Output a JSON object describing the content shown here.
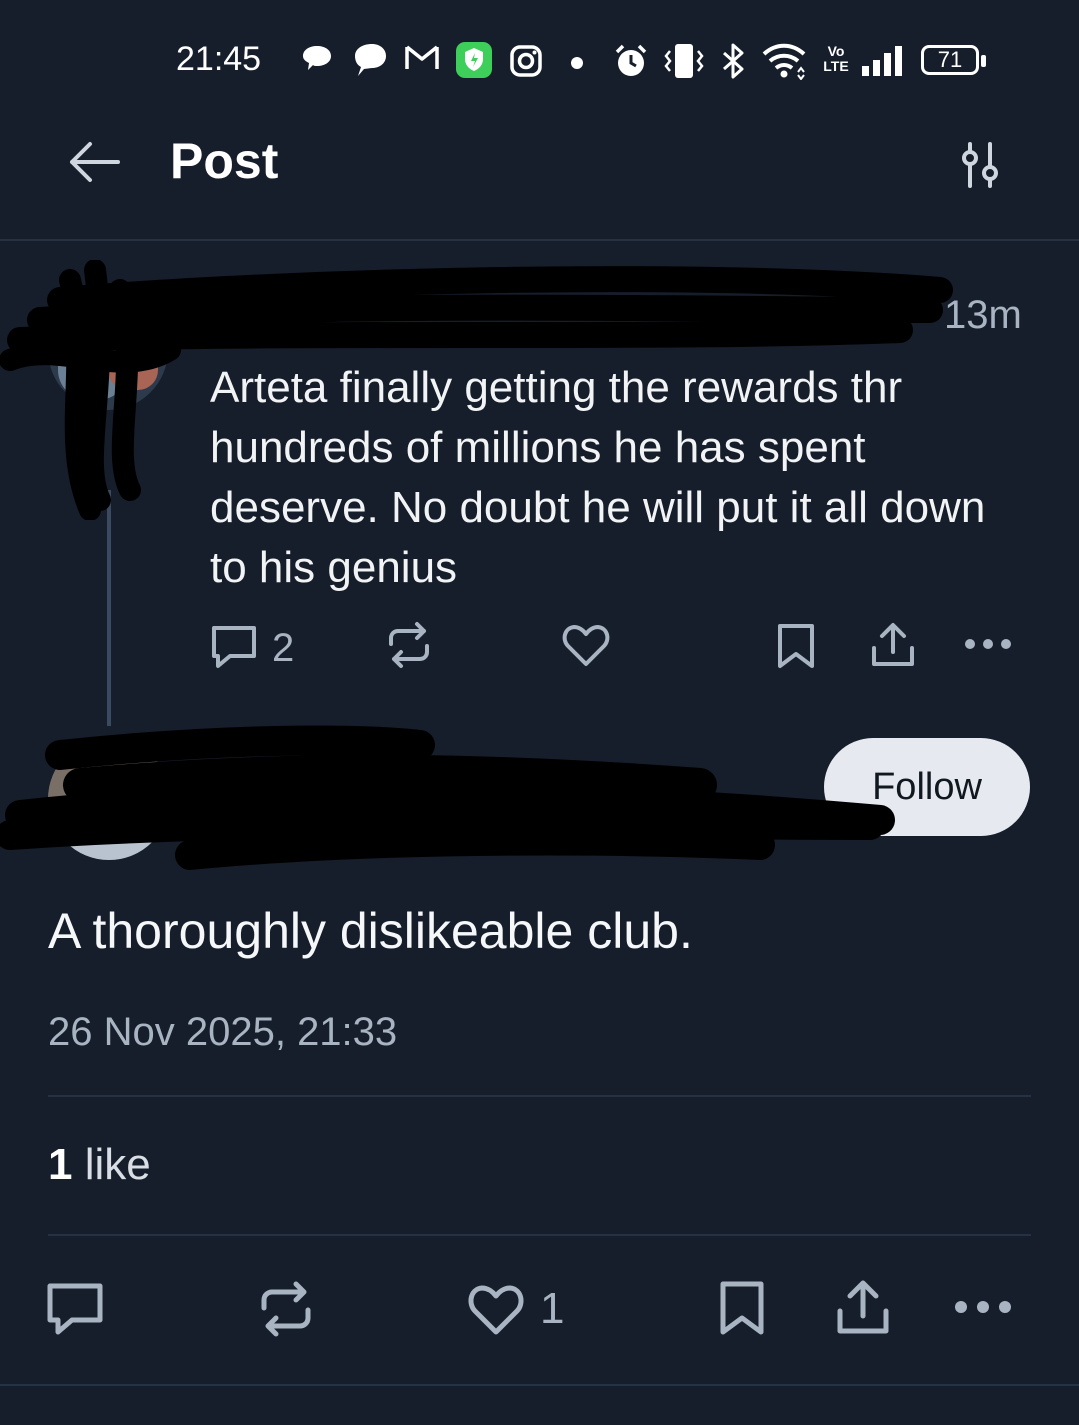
{
  "status_bar": {
    "time": "21:45",
    "battery": "71",
    "network_badge": "Vo LTE",
    "icons": [
      "chat-bubble-icon",
      "speech-icon",
      "gmail-icon",
      "shield-app-icon",
      "instagram-icon",
      "dot-icon",
      "alarm-icon",
      "vibrate-icon",
      "bluetooth-icon",
      "wifi-icon",
      "volte-icon",
      "signal-icon",
      "battery-icon"
    ]
  },
  "header": {
    "title": "Post",
    "back_icon": "arrow-left-icon",
    "settings_icon": "sliders-icon"
  },
  "parent_post": {
    "time_ago": "13m",
    "text": "Arteta finally getting the rewards thr hundreds of millions he has spent deserve. No doubt he will put it all down to his genius",
    "reply_count": "2",
    "actions": [
      "reply-icon",
      "repost-icon",
      "like-icon",
      "bookmark-icon",
      "share-icon",
      "more-icon"
    ]
  },
  "main_post": {
    "follow_label": "Follow",
    "text": "A thoroughly dislikeable club.",
    "timestamp": "26 Nov 2025, 21:33",
    "like_summary": {
      "count": "1",
      "label": "like"
    },
    "like_count": "1",
    "actions": [
      "reply-icon",
      "repost-icon",
      "like-icon",
      "bookmark-icon",
      "share-icon",
      "more-icon"
    ]
  },
  "colors": {
    "background": "#161e2b",
    "text": "#f1f3f5",
    "muted": "#a9b4c2",
    "divider": "#253244",
    "follow_bg": "#e6eaf0"
  }
}
